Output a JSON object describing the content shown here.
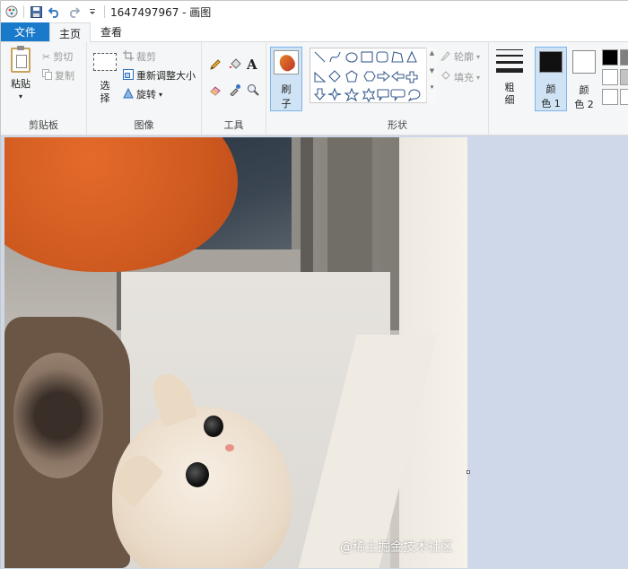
{
  "window": {
    "title": "1647497967 - 画图"
  },
  "quick_access": {
    "icons": [
      "paint-app-icon",
      "save-icon",
      "undo-icon",
      "redo-icon",
      "customize-dropdown-icon"
    ]
  },
  "tabs": [
    {
      "label": "文件"
    },
    {
      "label": "主页"
    },
    {
      "label": "查看"
    }
  ],
  "clipboard": {
    "paste": "粘贴",
    "cut": "剪切",
    "copy": "复制",
    "group_label": "剪贴板"
  },
  "image_group": {
    "select_line1": "选",
    "select_line2": "择",
    "crop": "裁剪",
    "resize": "重新调整大小",
    "rotate": "旋转",
    "group_label": "图像"
  },
  "tools_group": {
    "text_glyph": "A",
    "group_label": "工具"
  },
  "brush": {
    "line1": "刷",
    "line2": "子"
  },
  "shapes_group": {
    "outline": "轮廓",
    "fill": "填充",
    "group_label": "形状"
  },
  "thickness": {
    "line1": "粗",
    "line2": "细"
  },
  "color1": {
    "line1": "颜",
    "line2": "色 1",
    "swatch": "#111111"
  },
  "color2": {
    "line1": "颜",
    "line2": "色 2",
    "swatch": "#ffffff"
  },
  "colors": {
    "file_tab": "#1979ca",
    "ribbon_bg": "#f5f6f7",
    "selected_bg": "#cfe3f5",
    "workspace_bg": "#cfd8e8"
  },
  "watermark": "@稀土掘金技术社区"
}
